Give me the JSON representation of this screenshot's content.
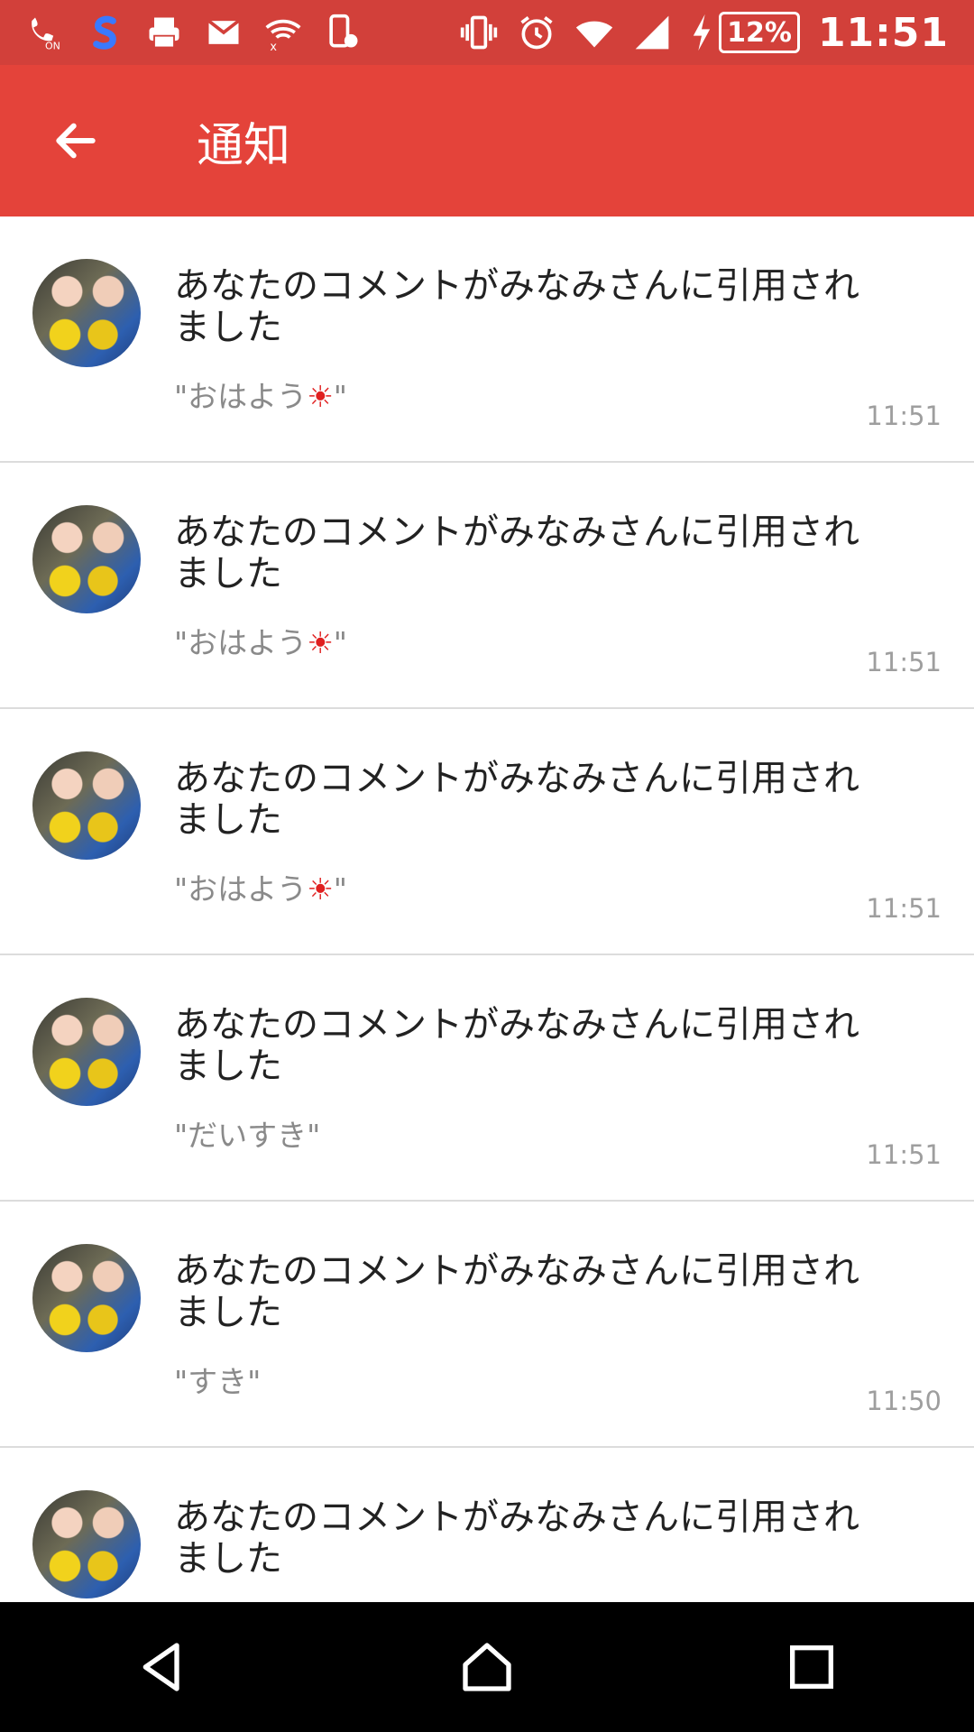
{
  "status_bar": {
    "battery_percent": "12%",
    "clock": "11:51",
    "icons": [
      "wifi-calling-on-icon",
      "s-app-icon",
      "printer-icon",
      "mail-icon",
      "wifi-off-icon",
      "device-settings-icon",
      "vibrate-icon",
      "alarm-icon",
      "wifi-icon",
      "signal-icon",
      "charging-icon"
    ]
  },
  "app_bar": {
    "title": "通知"
  },
  "notifications": [
    {
      "message": "あなたのコメントがみなみさんに引用されました",
      "quote": "\"おはよう☀\"",
      "time": "11:51"
    },
    {
      "message": "あなたのコメントがみなみさんに引用されました",
      "quote": "\"おはよう☀\"",
      "time": "11:51"
    },
    {
      "message": "あなたのコメントがみなみさんに引用されました",
      "quote": "\"おはよう☀\"",
      "time": "11:51"
    },
    {
      "message": "あなたのコメントがみなみさんに引用されました",
      "quote": "\"だいすき\"",
      "time": "11:51"
    },
    {
      "message": "あなたのコメントがみなみさんに引用されました",
      "quote": "\"すき\"",
      "time": "11:50"
    },
    {
      "message": "あなたのコメントがみなみさんに引用されました",
      "quote": "",
      "time": ""
    }
  ],
  "nav_bar": {
    "icons": [
      "back-icon",
      "home-icon",
      "recents-icon"
    ]
  },
  "colors": {
    "status_bar": "#d2403a",
    "app_bar": "#e4433a",
    "quote_sun": "#e02020"
  }
}
